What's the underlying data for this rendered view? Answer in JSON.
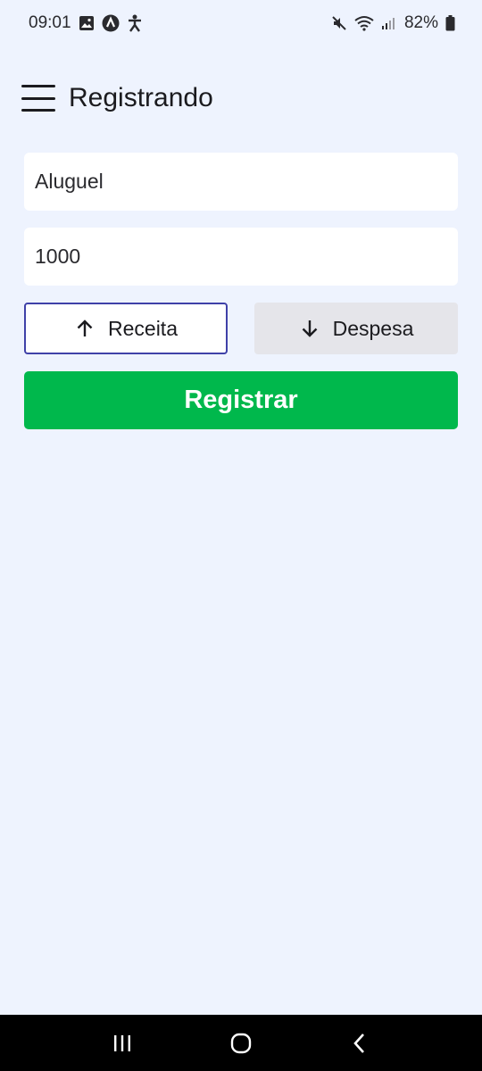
{
  "status_bar": {
    "time": "09:01",
    "battery": "82%",
    "icons_left": [
      "image-icon",
      "app-logo-icon",
      "accessibility-icon"
    ],
    "icons_right": [
      "mute-icon",
      "wifi-icon",
      "signal-icon",
      "battery-icon"
    ]
  },
  "app_bar": {
    "title": "Registrando",
    "menu_icon": "menu-icon"
  },
  "form": {
    "description_value": "Aluguel",
    "amount_value": "1000",
    "type_income_label": "Receita",
    "type_expense_label": "Despesa",
    "selected_type": "Receita",
    "submit_label": "Registrar"
  },
  "colors": {
    "background": "#eef3fe",
    "submit": "#00b84c",
    "selected_border": "#3f41a8",
    "unselected_bg": "#e5e5ea"
  },
  "nav_bar": {
    "buttons": [
      "recent-apps-icon",
      "home-icon",
      "back-icon"
    ]
  }
}
